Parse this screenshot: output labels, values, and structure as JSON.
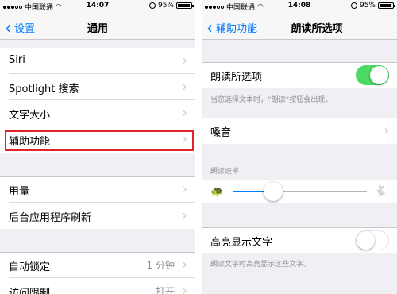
{
  "left": {
    "status": {
      "carrier": "中国联通",
      "time": "14:07",
      "battery": "95%"
    },
    "nav": {
      "back_label": "设置",
      "title": "通用"
    },
    "group1": [
      "Siri",
      "Spotlight 搜索",
      "文字大小",
      "辅助功能"
    ],
    "group2": [
      "用量",
      "后台应用程序刷新"
    ],
    "group3": [
      {
        "label": "自动锁定",
        "detail": "1 分钟"
      },
      {
        "label": "访问限制",
        "detail": "打开"
      }
    ]
  },
  "right": {
    "status": {
      "carrier": "中国联通",
      "time": "14:08",
      "battery": "95%"
    },
    "nav": {
      "back_label": "辅助功能",
      "title": "朗读所选项"
    },
    "speak_selection": {
      "label": "朗读所选项",
      "on": true
    },
    "speak_footer": "当您选择文本时，“朗读”按钮会出现。",
    "voices": {
      "label": "嗓音"
    },
    "rate_header": "朗读速率",
    "rate": {
      "value": 0.3
    },
    "highlight_words": {
      "label": "高亮显示文字",
      "on": false
    },
    "highlight_footer": "朗读文字时高亮显示这些文字。"
  },
  "icons": [
    "signal-icon",
    "wifi-icon",
    "alarm-icon",
    "battery-icon",
    "back-chevron-icon",
    "chevron-right-icon",
    "turtle-icon",
    "rabbit-icon"
  ],
  "colors": {
    "accent": "#007aff",
    "toggle_on": "#4cd964",
    "highlight_box": "#e0232a"
  }
}
